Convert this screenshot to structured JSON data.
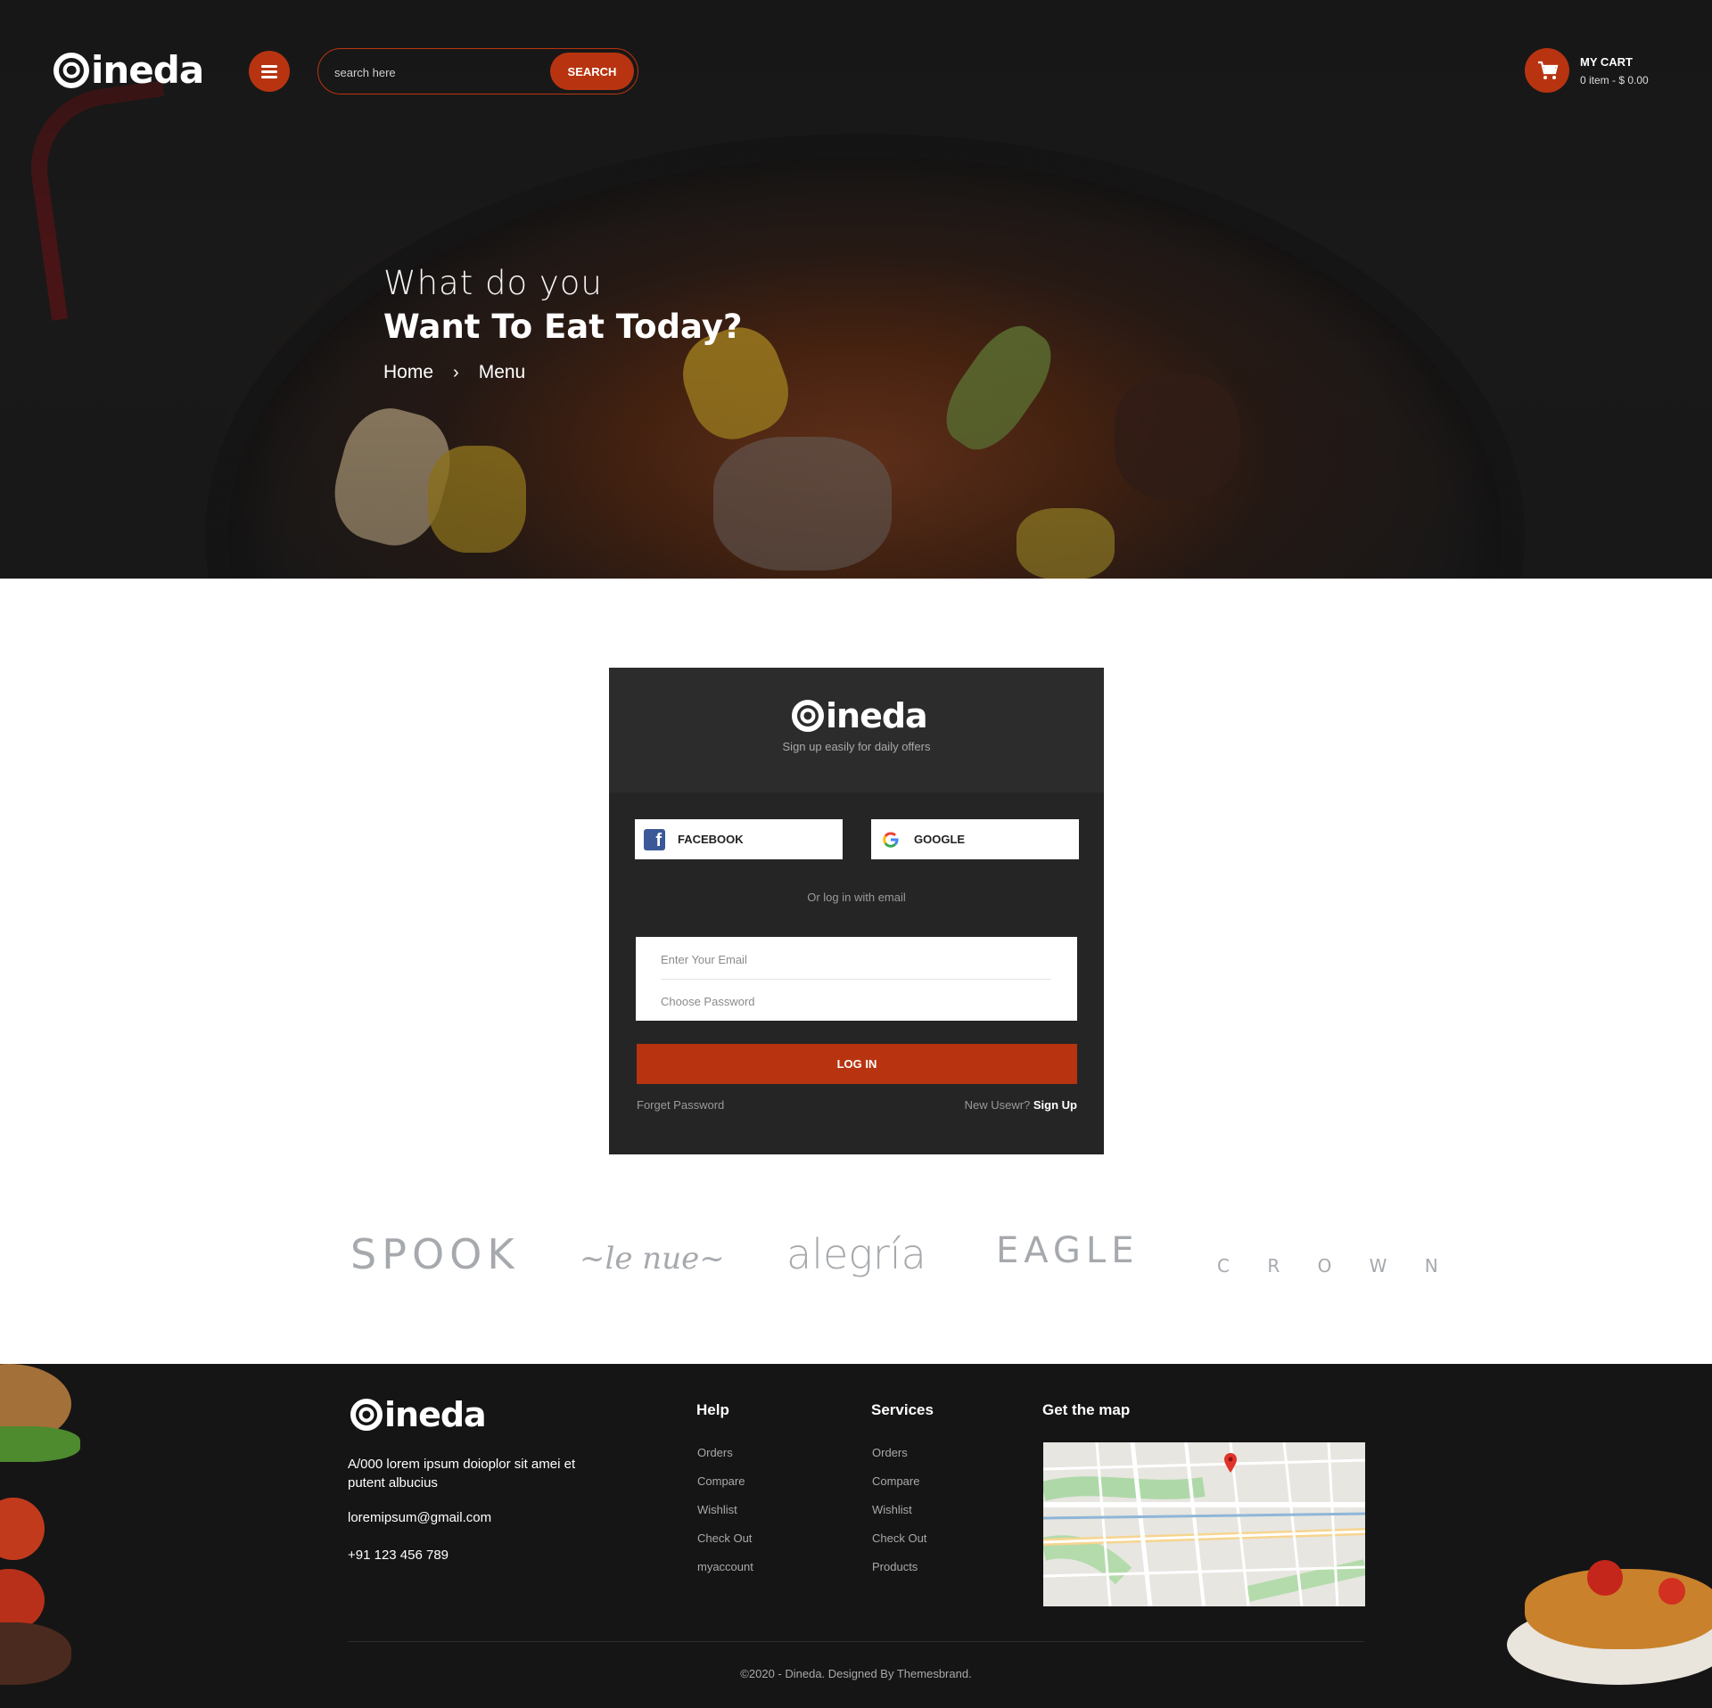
{
  "header": {
    "brand": "ineda",
    "search_placeholder": "search here",
    "search_button": "SEARCH",
    "cart_title": "MY CART",
    "cart_summary": "0 item - $ 0.00"
  },
  "hero": {
    "line1": "What do you",
    "line2": "Want To Eat Today?",
    "breadcrumb": [
      "Home",
      "Menu"
    ]
  },
  "login": {
    "brand": "ineda",
    "tagline": "Sign up easily for daily offers",
    "facebook": "FACEBOOK",
    "google": "GOOGLE",
    "or_text": "Or log in with email",
    "email_placeholder": "Enter Your Email",
    "password_placeholder": "Choose Password",
    "login_button": "LOG IN",
    "forgot": "Forget Password",
    "new_user": "New Usewr?",
    "signup": "Sign Up"
  },
  "brands": [
    "SPOOK",
    "le nue",
    "alegría",
    "EAGLE",
    "C R O W N"
  ],
  "footer": {
    "brand": "ineda",
    "address": "A/000  lorem ipsum doioplor sit amei et putent albucius",
    "email": "loremipsum@gmail.com",
    "phone": "+91 123 456 789",
    "help_title": "Help",
    "help_links": [
      "Orders",
      "Compare",
      "Wishlist",
      "Check Out",
      "myaccount"
    ],
    "services_title": "Services",
    "services_links": [
      "Orders",
      "Compare",
      "Wishlist",
      "Check Out",
      "Products"
    ],
    "map_title": "Get the map",
    "copyright": "©2020 - Dineda. Designed By Themesbrand."
  },
  "colors": {
    "accent": "#b83410",
    "card_bg": "#252525",
    "footer_bg": "#151515"
  }
}
